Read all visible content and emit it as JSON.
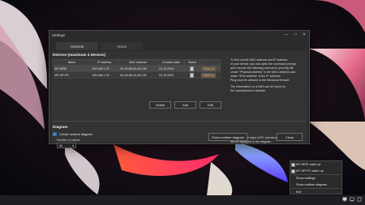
{
  "window": {
    "title": "Settings",
    "controls": {
      "minimize": "—",
      "maximize": "□",
      "close": "✕"
    }
  },
  "tabs": [
    {
      "label": "General",
      "active": true
    },
    {
      "label": "About",
      "active": false
    }
  ],
  "devices": {
    "title": "Devices (maximum 4 devices)",
    "columns": [
      "Name",
      "IP address",
      "MAC address",
      "Creation date",
      "Status",
      ""
    ],
    "rows": [
      {
        "name": "MY WSE",
        "ip": "192.168.1.75",
        "mac": "00-1D-60-4A-8C-CB",
        "date": "21.10.2024",
        "action": "Wake up"
      },
      {
        "name": "MY HP-PC",
        "ip": "192.168.1.75",
        "mac": "00-1D-60-4A-8C-CB",
        "date": "21.10.2024",
        "action": "Wake up"
      }
    ],
    "buttons": {
      "delete": "Delete",
      "add": "Add",
      "edit": "Edit"
    }
  },
  "help_text": {
    "p1_line1": "To find out the MAC address and IP address",
    "p1_line2": "of your device, you can open the command prompt",
    "p1_line3": "and execute the following command: ipconfig /all.",
    "p1_line4": "Under \"Physical address\" is the MAC address and",
    "p1_line5": "under \"IPv4 address\" is the IP address.",
    "p1_line6": "Ping must be allowed in the Windows firewall!",
    "p2_line1": "The information on a NAS can be found on",
    "p2_line2": "the manufacturer's website.",
    "p3_line1": "The last active days of PC and server/NAS",
    "p3_line2": "will be displayed in the diagram."
  },
  "diagram": {
    "title": "Diagram",
    "checkbox_label": "Create runtime diagram",
    "checked": true,
    "values_label": "Number of values:",
    "values_selected": "30"
  },
  "footer_buttons": {
    "show_diagram": "Show runtime diagram",
    "close": "Close"
  },
  "tray_menu": {
    "items": [
      {
        "label": "MY WSE wake up"
      },
      {
        "label": "MY HP-PC wake up"
      },
      {
        "label": "Show settings"
      },
      {
        "label": "Show runtime diagram"
      },
      {
        "label": "Exit"
      }
    ]
  },
  "colors": {
    "accent": "#2b6fb0",
    "wake_button": "#6b5a4a",
    "window_bg": "#2b2b2b"
  }
}
